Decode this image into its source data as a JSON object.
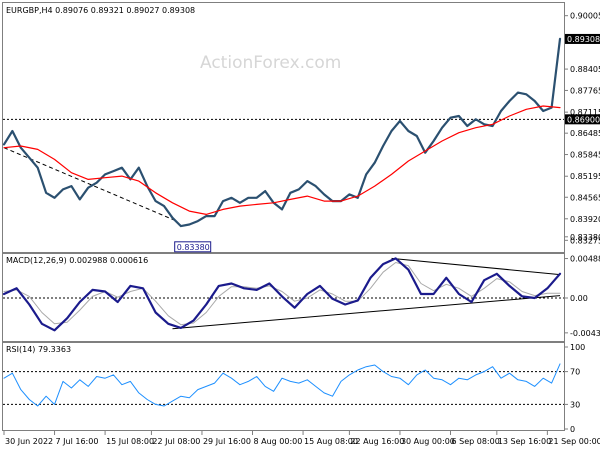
{
  "header": {
    "symbol_line": "EURGBP,H4  0.89076  0.89321  0.89027  0.89308",
    "watermark": "ActionForex.com"
  },
  "chart_data": [
    {
      "type": "line",
      "panel": "price",
      "title": "EURGBP,H4  0.89076  0.89321  0.89027  0.89308",
      "yticks": [
        "0.90005",
        "0.89308",
        "0.88405",
        "0.87765",
        "0.87115",
        "0.86900",
        "0.86485",
        "0.85845",
        "0.85195",
        "0.84565",
        "0.83920",
        "0.83380",
        "0.83275"
      ],
      "ylim": [
        0.82925,
        0.90355
      ],
      "y_axis_tags": [
        {
          "label": "0.89308",
          "value": 0.89308,
          "fill": "#000000",
          "text_color": "#ffffff"
        },
        {
          "label": "0.86900",
          "value": 0.869,
          "fill": "#000000",
          "text_color": "#ffffff"
        }
      ],
      "last_close": 0.89308,
      "horizontal_line": {
        "value": 0.869,
        "style": "dotted",
        "color": "#000000"
      },
      "low_label": {
        "text": "0.83380",
        "value": 0.8338,
        "x": 41
      },
      "trendline": {
        "color": "#000000",
        "style": "dashed",
        "points": [
          [
            0,
            0.8605
          ],
          [
            41,
            0.8385
          ]
        ]
      },
      "price_series": {
        "name": "",
        "color": "#2b5070",
        "x": [
          0,
          2,
          4,
          6,
          8,
          10,
          12,
          14,
          16,
          18,
          20,
          22,
          24,
          26,
          28,
          30,
          32,
          34,
          36,
          38,
          40,
          42,
          44,
          46,
          48,
          50,
          52,
          54,
          56,
          58,
          60,
          62,
          64,
          66,
          68,
          70,
          72,
          74,
          76,
          78,
          80,
          82,
          84,
          86,
          88,
          90,
          92,
          94,
          96,
          98,
          100,
          102,
          104,
          106,
          108,
          110,
          112,
          114,
          116,
          118,
          120,
          122,
          124,
          126,
          128,
          130,
          132
        ],
        "values": [
          0.8615,
          0.8655,
          0.8605,
          0.8575,
          0.8545,
          0.847,
          0.8455,
          0.848,
          0.849,
          0.845,
          0.8485,
          0.85,
          0.8525,
          0.8535,
          0.8545,
          0.851,
          0.8545,
          0.849,
          0.8445,
          0.843,
          0.8395,
          0.837,
          0.8375,
          0.8385,
          0.84,
          0.84,
          0.8445,
          0.8455,
          0.844,
          0.8455,
          0.8455,
          0.8475,
          0.844,
          0.842,
          0.847,
          0.848,
          0.8505,
          0.849,
          0.8465,
          0.8445,
          0.8445,
          0.8465,
          0.8455,
          0.8525,
          0.856,
          0.861,
          0.8655,
          0.8685,
          0.8655,
          0.864,
          0.859,
          0.8625,
          0.8665,
          0.8695,
          0.87,
          0.867,
          0.869,
          0.8675,
          0.867,
          0.8715,
          0.8745,
          0.877,
          0.8765,
          0.8745,
          0.8715,
          0.8725,
          0.8931
        ]
      },
      "ma_series": {
        "name": "",
        "color": "#ff0000",
        "x": [
          0,
          4,
          8,
          12,
          16,
          20,
          24,
          28,
          32,
          36,
          40,
          44,
          48,
          52,
          56,
          60,
          64,
          68,
          72,
          76,
          80,
          84,
          88,
          92,
          96,
          100,
          104,
          108,
          112,
          116,
          120,
          124,
          128,
          132
        ],
        "values": [
          0.8605,
          0.861,
          0.86,
          0.857,
          0.853,
          0.851,
          0.8515,
          0.852,
          0.8505,
          0.847,
          0.844,
          0.8415,
          0.8405,
          0.842,
          0.843,
          0.8435,
          0.844,
          0.845,
          0.846,
          0.8445,
          0.8445,
          0.846,
          0.849,
          0.8525,
          0.8565,
          0.8595,
          0.8625,
          0.865,
          0.8665,
          0.8675,
          0.87,
          0.872,
          0.873,
          0.8725
        ]
      }
    },
    {
      "type": "line",
      "panel": "macd",
      "title": "MACD(12,26,9) 0.002988 0.000616",
      "yticks": [
        "0.004885",
        "0.00",
        "-0.004315"
      ],
      "ylim": [
        -0.0052,
        0.0052
      ],
      "y_axis_tags": [],
      "zero_line": {
        "value": 0,
        "style": "dotted"
      },
      "trendlines": [
        {
          "color": "#000000",
          "points": [
            [
              40,
              -0.0038
            ],
            [
              132,
              0.0003
            ]
          ]
        },
        {
          "color": "#000000",
          "points": [
            [
              92,
              0.0049
            ],
            [
              132,
              0.0029
            ]
          ]
        }
      ],
      "series": [
        {
          "name": "",
          "color": "#1b1b8c",
          "x": [
            0,
            3,
            6,
            9,
            12,
            15,
            18,
            21,
            24,
            27,
            30,
            33,
            36,
            39,
            42,
            45,
            48,
            51,
            54,
            57,
            60,
            63,
            66,
            69,
            72,
            75,
            78,
            81,
            84,
            87,
            90,
            93,
            96,
            99,
            102,
            105,
            108,
            111,
            114,
            117,
            120,
            123,
            126,
            129,
            132
          ],
          "values": [
            0.0005,
            0.0012,
            -0.0008,
            -0.0032,
            -0.004,
            -0.0025,
            -0.0005,
            0.001,
            0.0008,
            -0.0005,
            0.0015,
            0.0012,
            -0.0018,
            -0.0032,
            -0.0037,
            -0.0028,
            -0.0008,
            0.0015,
            0.0018,
            0.0012,
            0.001,
            0.0018,
            0.0002,
            -0.0012,
            0.0005,
            0.0015,
            -0.0001,
            -0.0008,
            -0.0003,
            0.0025,
            0.0042,
            0.0049,
            0.0035,
            0.0005,
            0.0005,
            0.0025,
            0.0005,
            -0.0005,
            0.0022,
            0.003,
            0.0015,
            0.0002,
            0.0,
            0.0012,
            0.003
          ]
        },
        {
          "name": "",
          "color": "#a9a9a9",
          "x": [
            0,
            3,
            6,
            9,
            12,
            15,
            18,
            21,
            24,
            27,
            30,
            33,
            36,
            39,
            42,
            45,
            48,
            51,
            54,
            57,
            60,
            63,
            66,
            69,
            72,
            75,
            78,
            81,
            84,
            87,
            90,
            93,
            96,
            99,
            102,
            105,
            108,
            111,
            114,
            117,
            120,
            123,
            126,
            129,
            132
          ],
          "values": [
            0.0008,
            0.001,
            0.0002,
            -0.0018,
            -0.0032,
            -0.003,
            -0.0015,
            0.0002,
            0.0008,
            0.0001,
            0.0008,
            0.0012,
            -0.0004,
            -0.0022,
            -0.0033,
            -0.0031,
            -0.0018,
            0.0002,
            0.0014,
            0.0014,
            0.0012,
            0.0015,
            0.0008,
            -0.0004,
            0.0,
            0.001,
            0.0005,
            -0.0004,
            -0.0004,
            0.0012,
            0.0032,
            0.0044,
            0.004,
            0.0018,
            0.0009,
            0.0017,
            0.0012,
            0.0002,
            0.0012,
            0.0024,
            0.002,
            0.0008,
            0.0003,
            0.0006,
            0.0006
          ]
        }
      ]
    },
    {
      "type": "line",
      "panel": "rsi",
      "title": "RSI(14) 79.3363",
      "yticks": [
        "100",
        "70",
        "30",
        "0"
      ],
      "ylim": [
        0,
        100
      ],
      "reference_lines": [
        70,
        30
      ],
      "series": [
        {
          "name": "",
          "color": "#1e90ff",
          "x": [
            0,
            2,
            4,
            6,
            8,
            10,
            12,
            14,
            16,
            18,
            20,
            22,
            24,
            26,
            28,
            30,
            32,
            34,
            36,
            38,
            40,
            42,
            44,
            46,
            48,
            50,
            52,
            54,
            56,
            58,
            60,
            62,
            64,
            66,
            68,
            70,
            72,
            74,
            76,
            78,
            80,
            82,
            84,
            86,
            88,
            90,
            92,
            94,
            96,
            98,
            100,
            102,
            104,
            106,
            108,
            110,
            112,
            114,
            116,
            118,
            120,
            122,
            124,
            126,
            128,
            130,
            132
          ],
          "values": [
            62,
            68,
            48,
            36,
            28,
            40,
            30,
            58,
            50,
            60,
            52,
            64,
            62,
            66,
            54,
            58,
            44,
            36,
            30,
            28,
            34,
            40,
            38,
            48,
            52,
            56,
            68,
            62,
            54,
            58,
            64,
            52,
            46,
            62,
            58,
            56,
            60,
            52,
            44,
            40,
            58,
            66,
            72,
            76,
            78,
            70,
            64,
            62,
            54,
            66,
            72,
            62,
            60,
            54,
            62,
            60,
            66,
            70,
            76,
            62,
            68,
            60,
            58,
            52,
            62,
            56,
            79.3363
          ]
        }
      ]
    }
  ],
  "x_axis": {
    "labels": [
      {
        "text": "30 Jun 2022",
        "x": 0
      },
      {
        "text": "7 Jul 16:00",
        "x": 12
      },
      {
        "text": "15 Jul 08:00",
        "x": 24
      },
      {
        "text": "22 Jul 08:00",
        "x": 35
      },
      {
        "text": "29 Jul 16:00",
        "x": 47
      },
      {
        "text": "8 Aug 00:00",
        "x": 59
      },
      {
        "text": "15 Aug 08:00",
        "x": 71
      },
      {
        "text": "22 Aug 16:00",
        "x": 82
      },
      {
        "text": "30 Aug 00:00",
        "x": 94
      },
      {
        "text": "6 Sep 08:00",
        "x": 106
      },
      {
        "text": "13 Sep 16:00",
        "x": 117
      },
      {
        "text": "21 Sep 00:00",
        "x": 129
      }
    ]
  }
}
